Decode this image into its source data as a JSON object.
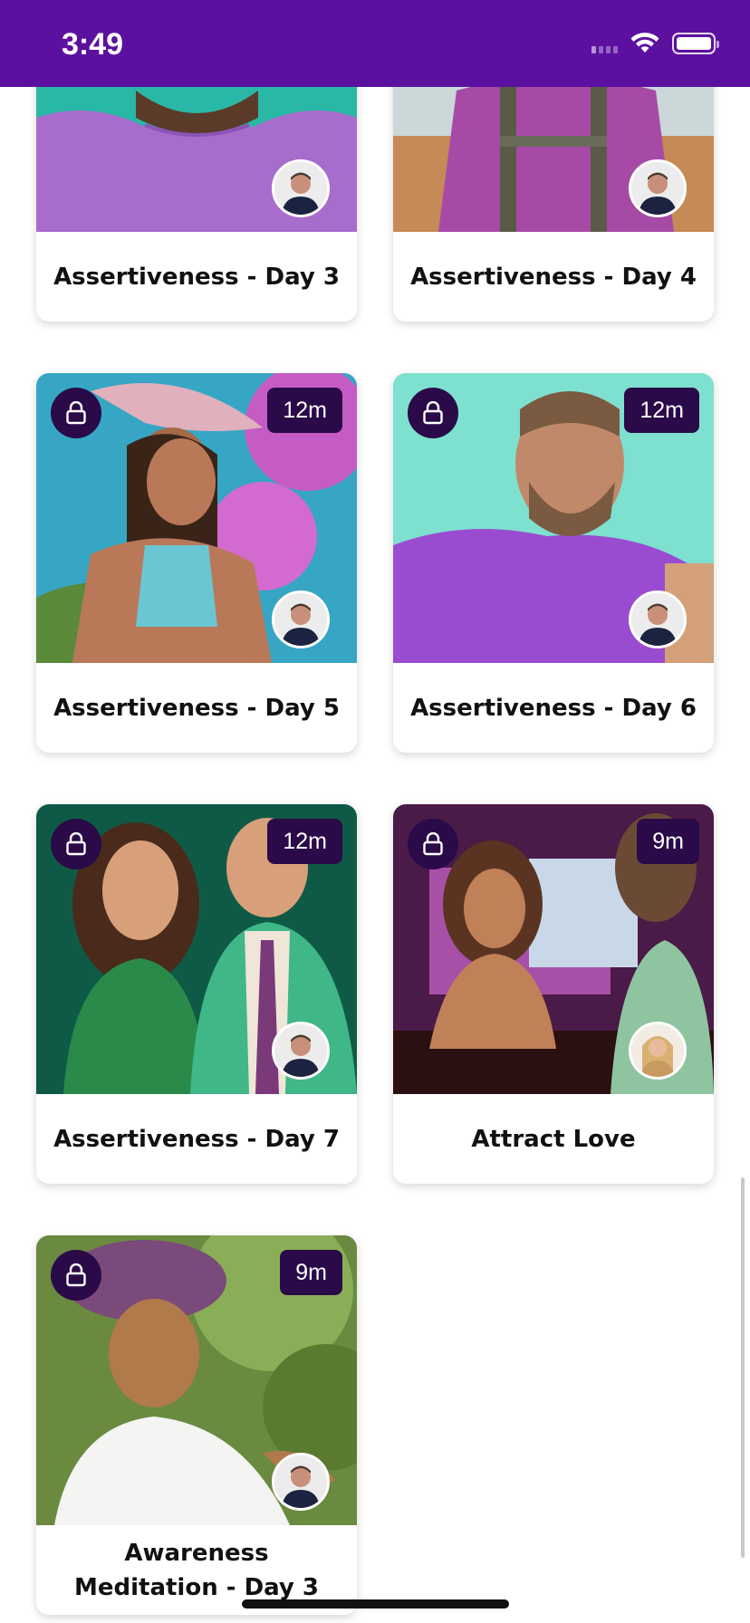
{
  "status_bar": {
    "time": "3:49",
    "icons": [
      "signal-icon",
      "wifi-icon",
      "battery-icon"
    ]
  },
  "colors": {
    "accent": "#5c10a0",
    "badge": "#2a0a48"
  },
  "cards": [
    {
      "title": "Assertiveness - Day 3",
      "duration": "",
      "locked": false,
      "host": "male"
    },
    {
      "title": "Assertiveness - Day 4",
      "duration": "",
      "locked": false,
      "host": "male"
    },
    {
      "title": "Assertiveness - Day 5",
      "duration": "12m",
      "locked": true,
      "host": "male"
    },
    {
      "title": "Assertiveness - Day 6",
      "duration": "12m",
      "locked": true,
      "host": "male"
    },
    {
      "title": "Assertiveness - Day 7",
      "duration": "12m",
      "locked": true,
      "host": "male"
    },
    {
      "title": "Attract Love",
      "duration": "9m",
      "locked": true,
      "host": "female"
    },
    {
      "title": "Awareness Meditation - Day 3",
      "duration": "9m",
      "locked": true,
      "host": "male"
    }
  ]
}
